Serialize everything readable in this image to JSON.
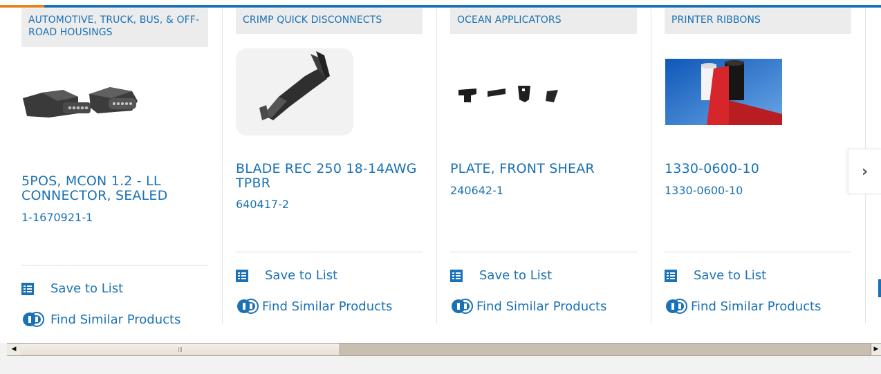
{
  "colors": {
    "accent": "#1a71b5",
    "topbar_orange": "#e8821e",
    "category_bg": "#ececec"
  },
  "actions": {
    "save_to_list": "Save to List",
    "find_similar": "Find Similar Products"
  },
  "products": [
    {
      "category": "AUTOMOTIVE, TRUCK, BUS, & OFF-ROAD HOUSINGS",
      "title": "5POS, MCON 1.2 - LL CONNECTOR, SEALED",
      "part_number": "1-1670921-1",
      "image": "connector-housing-image"
    },
    {
      "category": "CRIMP QUICK DISCONNECTS",
      "title": "BLADE REC 250 18-14AWG TPBR",
      "part_number": "640417-2",
      "image": "blade-receptacle-image"
    },
    {
      "category": "OCEAN APPLICATORS",
      "title": "PLATE, FRONT SHEAR",
      "part_number": "240642-1",
      "image": "shear-plate-parts-image"
    },
    {
      "category": "PRINTER RIBBONS",
      "title": "1330-0600-10",
      "part_number": "1330-0600-10",
      "image": "printer-ribbon-image"
    }
  ],
  "carousel": {
    "next_icon": "chevron-right-icon",
    "next_glyph": "›"
  },
  "scrollbar": {
    "left_glyph": "◀",
    "right_glyph": "▶",
    "grip": "III",
    "position": 0.0
  }
}
